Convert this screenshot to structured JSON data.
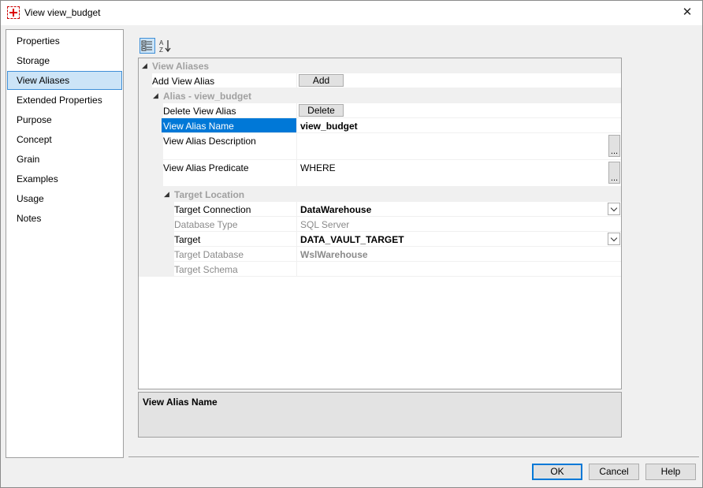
{
  "window": {
    "title": "View view_budget",
    "icon": "red-cross-icon",
    "close_glyph": "✕"
  },
  "nav": {
    "items": [
      {
        "label": "Properties",
        "selected": false
      },
      {
        "label": "Storage",
        "selected": false
      },
      {
        "label": "View Aliases",
        "selected": true
      },
      {
        "label": "Extended Properties",
        "selected": false
      },
      {
        "label": "Purpose",
        "selected": false
      },
      {
        "label": "Concept",
        "selected": false
      },
      {
        "label": "Grain",
        "selected": false
      },
      {
        "label": "Examples",
        "selected": false
      },
      {
        "label": "Usage",
        "selected": false
      },
      {
        "label": "Notes",
        "selected": false
      }
    ]
  },
  "toolbar": {
    "categorized_icon": "categorized-view-icon",
    "alphabetical_icon": "sort-alphabetical-icon"
  },
  "grid": {
    "category_view_aliases": "View Aliases",
    "add_view_alias_label": "Add View Alias",
    "add_button": "Add",
    "category_alias": "Alias - view_budget",
    "delete_view_alias_label": "Delete View Alias",
    "delete_button": "Delete",
    "view_alias_name_label": "View Alias Name",
    "view_alias_name_value": "view_budget",
    "view_alias_description_label": "View Alias Description",
    "view_alias_description_value": "",
    "view_alias_predicate_label": "View Alias Predicate",
    "view_alias_predicate_value": "WHERE",
    "ellipsis": "...",
    "category_target_location": "Target Location",
    "target_connection_label": "Target Connection",
    "target_connection_value": "DataWarehouse",
    "database_type_label": "Database Type",
    "database_type_value": "SQL Server",
    "target_label": "Target",
    "target_value": "DATA_VAULT_TARGET",
    "target_database_label": "Target Database",
    "target_database_value": "WslWarehouse",
    "target_schema_label": "Target Schema",
    "target_schema_value": ""
  },
  "help": {
    "title": "View Alias Name",
    "description": ""
  },
  "footer": {
    "ok": "OK",
    "cancel": "Cancel",
    "help": "Help"
  },
  "colors": {
    "selection": "#0078d7",
    "nav_selected_bg": "#cce4f7",
    "category_text": "#a0a0a0"
  }
}
